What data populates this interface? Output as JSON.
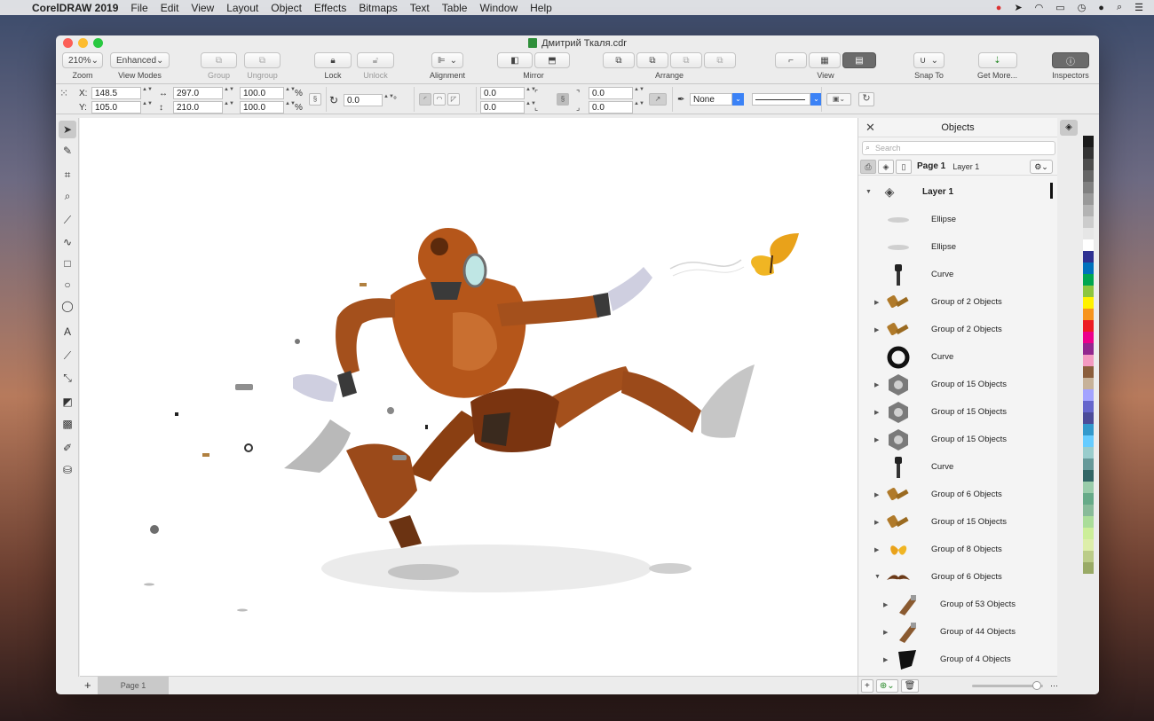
{
  "menubar": {
    "app_name": "CorelDRAW 2019",
    "menus": [
      "File",
      "Edit",
      "View",
      "Layout",
      "Object",
      "Effects",
      "Bitmaps",
      "Text",
      "Table",
      "Window",
      "Help"
    ]
  },
  "window": {
    "title": "Дмитрий Ткаля.cdr"
  },
  "toolbar": {
    "zoom_value": "210%",
    "zoom_label": "Zoom",
    "view_mode_value": "Enhanced",
    "view_mode_label": "View Modes",
    "group_label": "Group",
    "ungroup_label": "Ungroup",
    "lock_label": "Lock",
    "unlock_label": "Unlock",
    "alignment_label": "Alignment",
    "mirror_label": "Mirror",
    "arrange_label": "Arrange",
    "view_label": "View",
    "snap_to_label": "Snap To",
    "get_more_label": "Get More...",
    "inspectors_label": "Inspectors"
  },
  "propbar": {
    "x_label": "X:",
    "x_value": "148.5",
    "y_label": "Y:",
    "y_value": "105.0",
    "width_value": "297.0",
    "height_value": "210.0",
    "scale_x": "100.0",
    "scale_y": "100.0",
    "percent": "%",
    "rotation_value": "0.0",
    "degree": "°",
    "pos_a": "0.0",
    "pos_b": "0.0",
    "pos_c": "0.0",
    "pos_d": "0.0",
    "outline_value": "None"
  },
  "pagetabs": {
    "add": "+",
    "page_tab": "Page 1"
  },
  "docker": {
    "title": "Objects",
    "search_placeholder": "Search",
    "page_name": "Page 1",
    "layer_name": "Layer 1",
    "objects": [
      {
        "name": "Layer 1",
        "expand": "▼",
        "level": 0,
        "icon": "layers-icon"
      },
      {
        "name": "Ellipse",
        "expand": "",
        "level": 1,
        "icon": "ellipse-thumb"
      },
      {
        "name": "Ellipse",
        "expand": "",
        "level": 1,
        "icon": "ellipse-thumb"
      },
      {
        "name": "Curve",
        "expand": "",
        "level": 1,
        "icon": "bolt-thumb"
      },
      {
        "name": "Group of 2 Objects",
        "expand": "▶",
        "level": 1,
        "icon": "screw-thumb"
      },
      {
        "name": "Group of 2 Objects",
        "expand": "▶",
        "level": 1,
        "icon": "screw-thumb"
      },
      {
        "name": "Curve",
        "expand": "",
        "level": 1,
        "icon": "ring-thumb"
      },
      {
        "name": "Group of 15 Objects",
        "expand": "▶",
        "level": 1,
        "icon": "nut-thumb"
      },
      {
        "name": "Group of 15 Objects",
        "expand": "▶",
        "level": 1,
        "icon": "nut-thumb"
      },
      {
        "name": "Group of 15 Objects",
        "expand": "▶",
        "level": 1,
        "icon": "nut-thumb"
      },
      {
        "name": "Curve",
        "expand": "",
        "level": 1,
        "icon": "bolt-thumb"
      },
      {
        "name": "Group of 6 Objects",
        "expand": "▶",
        "level": 1,
        "icon": "screw-thumb"
      },
      {
        "name": "Group of 15 Objects",
        "expand": "▶",
        "level": 1,
        "icon": "screw-thumb"
      },
      {
        "name": "Group of 8 Objects",
        "expand": "▶",
        "level": 1,
        "icon": "butterfly-thumb"
      },
      {
        "name": "Group of 6 Objects",
        "expand": "▼",
        "level": 1,
        "icon": "mustache-thumb"
      },
      {
        "name": "Group of 53 Objects",
        "expand": "▶",
        "level": 2,
        "icon": "leg-thumb"
      },
      {
        "name": "Group of 44 Objects",
        "expand": "▶",
        "level": 2,
        "icon": "leg-thumb"
      },
      {
        "name": "Group of 4 Objects",
        "expand": "▶",
        "level": 2,
        "icon": "shape-thumb"
      }
    ]
  },
  "colors": {
    "accent": "#3b82f6",
    "robot_orange": "#b5561a",
    "palette": [
      "#1a1a1a",
      "#333333",
      "#4d4d4d",
      "#666666",
      "#808080",
      "#999999",
      "#b3b3b3",
      "#cccccc",
      "#e6e6e6",
      "#ffffff",
      "#2e3192",
      "#0071bc",
      "#00a651",
      "#8dc63f",
      "#fff200",
      "#f7941d",
      "#ed1c24",
      "#ec008c",
      "#92278f",
      "#f49ac1",
      "#8b5e3c",
      "#c7b299",
      "#a3a3ff",
      "#6666cc",
      "#4c4c99",
      "#3399cc",
      "#66ccff",
      "#99cccc",
      "#669999",
      "#336666",
      "#99ccaa",
      "#66aa88",
      "#88bb99",
      "#aadd99",
      "#ccee99",
      "#ddeeaa",
      "#bbcc88",
      "#99aa66"
    ]
  }
}
